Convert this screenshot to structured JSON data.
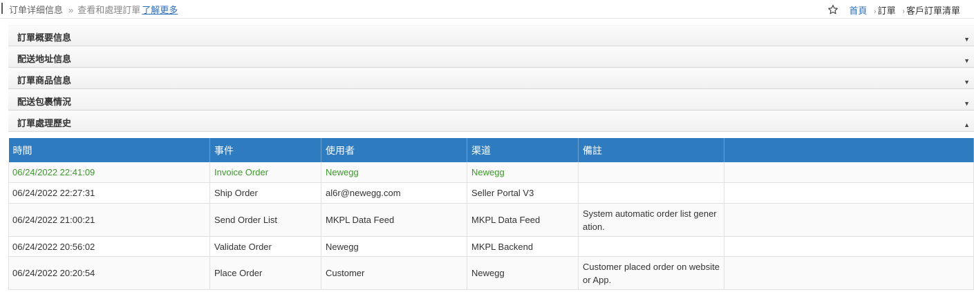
{
  "header": {
    "title": "订单详细信息",
    "separator": "»",
    "subtitle": "查看和處理訂單",
    "learn_more": "了解更多",
    "breadcrumb": {
      "home": "首頁",
      "arrow": "›",
      "level1": "訂單",
      "level2": "客戶訂單清單"
    }
  },
  "panels": [
    {
      "label": "訂單概要信息",
      "state": "collapsed",
      "toggle": "▼"
    },
    {
      "label": "配送地址信息",
      "state": "collapsed",
      "toggle": "▼"
    },
    {
      "label": "訂單商品信息",
      "state": "collapsed",
      "toggle": "▼"
    },
    {
      "label": "配送包裹情況",
      "state": "collapsed",
      "toggle": "▼"
    },
    {
      "label": "訂單處理歷史",
      "state": "expanded",
      "toggle": "▲"
    }
  ],
  "history": {
    "columns": [
      "時間",
      "事件",
      "使用者",
      "渠道",
      "備註",
      ""
    ],
    "rows": [
      {
        "time": "06/24/2022 22:41:09",
        "event": "Invoice Order",
        "user": "Newegg",
        "channel": "Newegg",
        "note": ""
      },
      {
        "time": "06/24/2022 22:27:31",
        "event": "Ship Order",
        "user": "al6r@newegg.com",
        "channel": "Seller Portal V3",
        "note": ""
      },
      {
        "time": "06/24/2022 21:00:21",
        "event": "Send Order List",
        "user": "MKPL Data Feed",
        "channel": "MKPL Data Feed",
        "note": "System automatic order list gener ation."
      },
      {
        "time": "06/24/2022 20:56:02",
        "event": "Validate Order",
        "user": "Newegg",
        "channel": "MKPL Backend",
        "note": ""
      },
      {
        "time": "06/24/2022 20:20:54",
        "event": "Place Order",
        "user": "Customer",
        "channel": "Newegg",
        "note": "Customer placed order on website or App."
      }
    ]
  },
  "colors": {
    "table_header": "#2e7bc0",
    "highlight_text": "#3a9a2a",
    "link": "#2a6ebb"
  }
}
